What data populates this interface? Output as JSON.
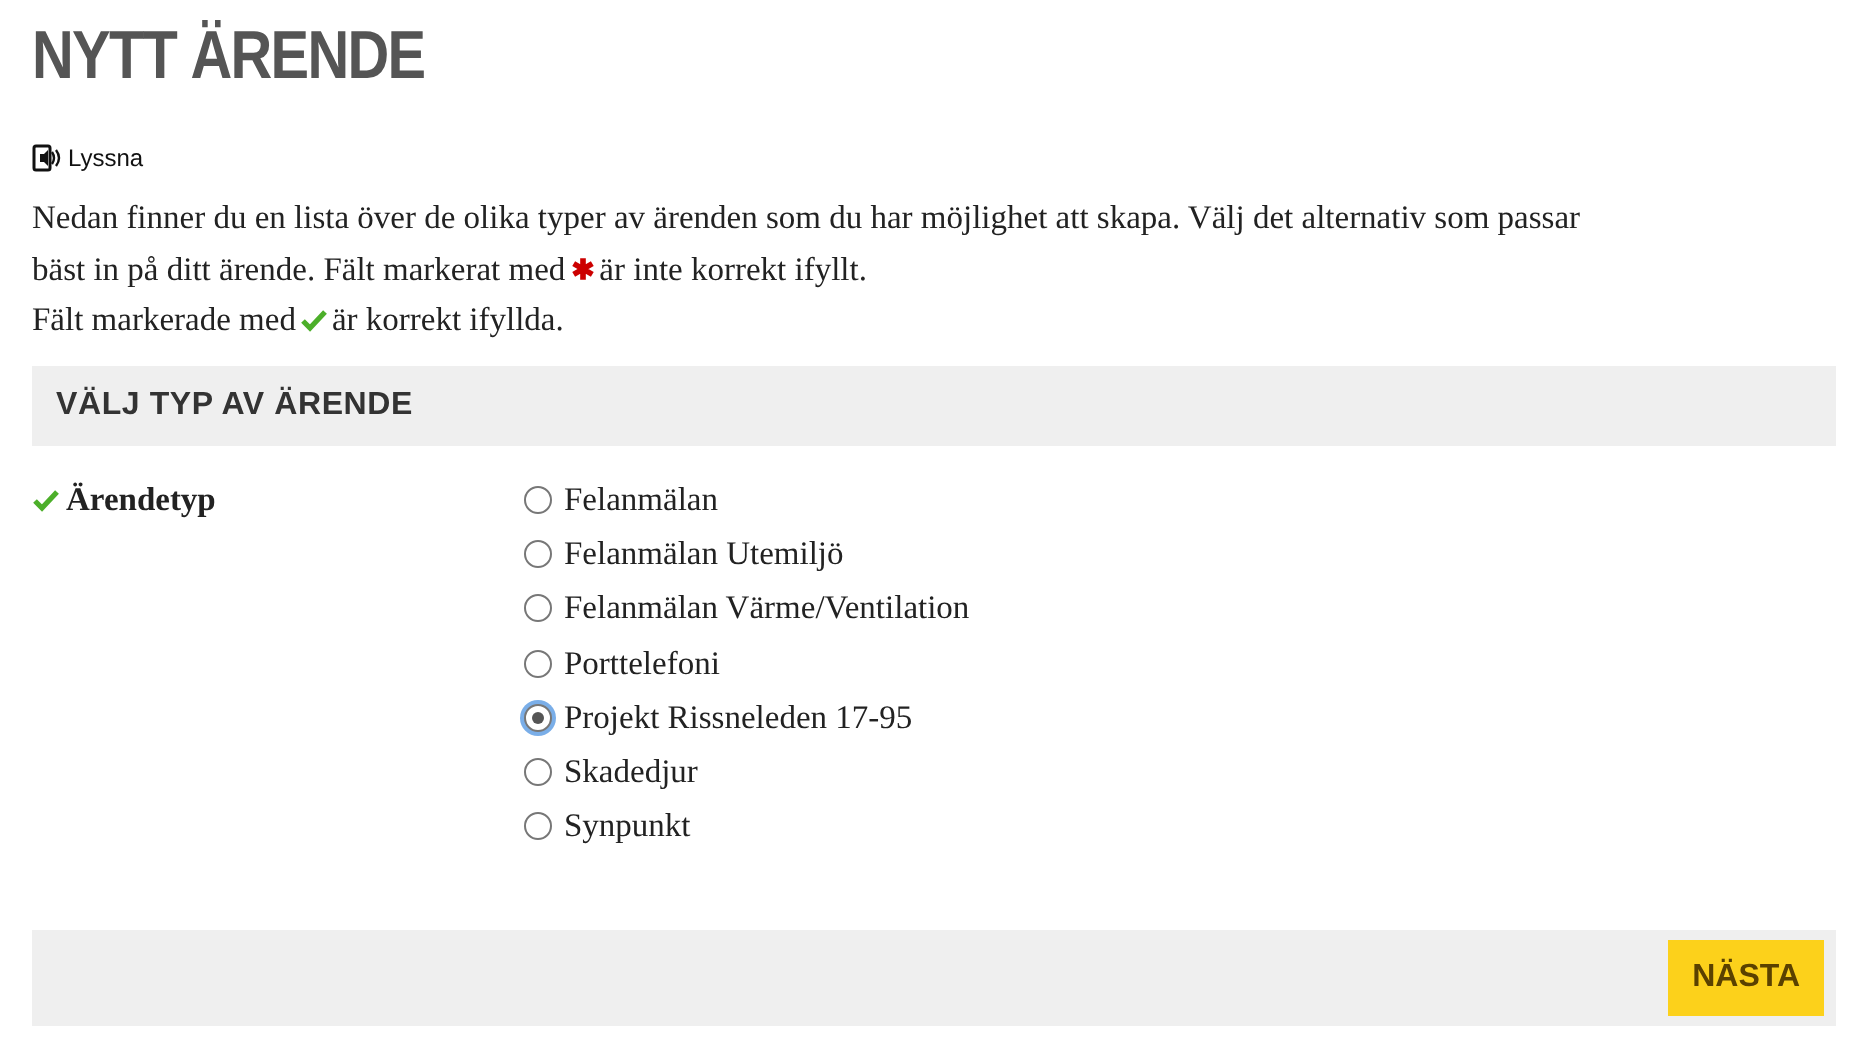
{
  "title": "NYTT ÄRENDE",
  "listen": {
    "label": "Lyssna"
  },
  "intro": {
    "first_line": "Nedan finner du en lista över de olika typer av ärenden som du har möjlighet att skapa. Välj det alternativ som passar",
    "before_invalid": "bäst in på ditt ärende. Fält markerat med",
    "after_invalid": "är inte korrekt ifyllt.",
    "before_valid": "Fält markerade med",
    "after_valid": "är korrekt ifyllda."
  },
  "section": {
    "heading": "VÄLJ TYP AV ÄRENDE",
    "field": {
      "label": "Ärendetyp",
      "valid": true,
      "options": [
        {
          "label": "Felanmälan",
          "selected": false
        },
        {
          "label": "Felanmälan Utemiljö",
          "selected": false
        },
        {
          "label": "Felanmälan Värme/Ventilation",
          "selected": false
        },
        {
          "label": "Porttelefoni",
          "selected": false
        },
        {
          "label": "Projekt Rissneleden 17-95",
          "selected": true
        },
        {
          "label": "Skadedjur",
          "selected": false
        },
        {
          "label": "Synpunkt",
          "selected": false
        }
      ]
    }
  },
  "next_button": "NÄSTA"
}
